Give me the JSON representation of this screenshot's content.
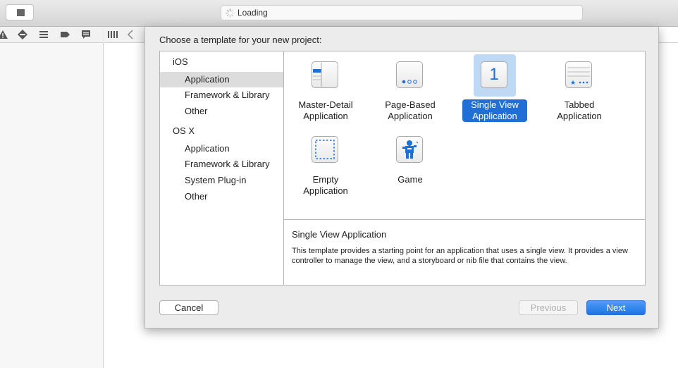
{
  "window": {
    "status_text": "Loading"
  },
  "sheet": {
    "title": "Choose a template for your new project:",
    "categories": [
      {
        "header": "iOS",
        "items": [
          "Application",
          "Framework & Library",
          "Other"
        ]
      },
      {
        "header": "OS X",
        "items": [
          "Application",
          "Framework & Library",
          "System Plug-in",
          "Other"
        ]
      }
    ],
    "selected_category": "iOS / Application",
    "templates": [
      {
        "line1": "Master-Detail",
        "line2": "Application"
      },
      {
        "line1": "Page-Based",
        "line2": "Application"
      },
      {
        "line1": "Single View",
        "line2": "Application",
        "selected": true,
        "icon_glyph": "1"
      },
      {
        "line1": "Tabbed",
        "line2": "Application"
      },
      {
        "line1": "Empty",
        "line2": "Application"
      },
      {
        "line1": "Game",
        "line2": ""
      }
    ],
    "description": {
      "title": "Single View Application",
      "body": "This template provides a starting point for an application that uses a single view. It provides a view controller to manage the view, and a storyboard or nib file that contains the view."
    },
    "buttons": {
      "cancel": "Cancel",
      "previous": "Previous",
      "next": "Next"
    }
  },
  "colors": {
    "accent": "#1f6fd6",
    "selection_bg": "#bfd8f4"
  }
}
